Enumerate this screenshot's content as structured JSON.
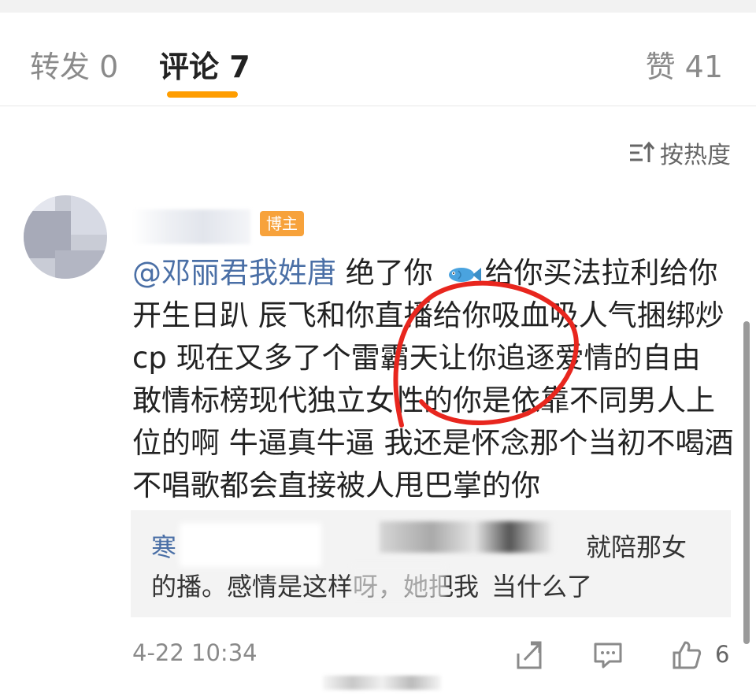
{
  "tabs": [
    {
      "label": "转发 0"
    },
    {
      "label": "评论 7"
    },
    {
      "label": "赞 41"
    }
  ],
  "sort": {
    "label": "按热度"
  },
  "comment": {
    "badge": "博主",
    "mention": "@邓丽君我姓唐",
    "text_before_fish": " 绝了你 ",
    "text_after_fish": "给你买法拉利给你开生日趴 辰飞和你直播给你吸血吸人气捆绑炒cp 现在又多了个雷霸天让你追逐爱情的自由 敢情标榜现代独立女性的你是依靠不同男人上位的啊 牛逼真牛逼 我还是怀念那个当初不喝酒不唱歌都会直接被人甩巴掌的你",
    "time": "4-22 10:34",
    "like_count": "6"
  },
  "reply": {
    "name": "寒",
    "text_a": "就陪那女",
    "text_b": "的播。感情是这样呀，她把我",
    "text_c": "当什么了"
  },
  "colors": {
    "accent": "#ff9d00",
    "link": "#4a6fa6",
    "badge": "#f7a23b",
    "annotation": "#e8261e"
  }
}
